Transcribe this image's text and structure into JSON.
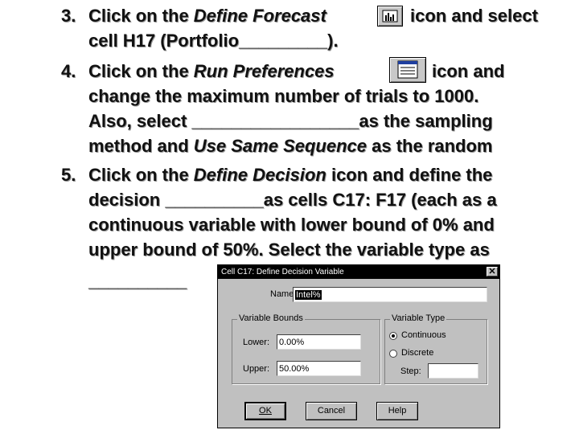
{
  "steps": [
    {
      "number": "3.",
      "line1": {
        "a": "Click on the ",
        "b": "Define Forecast",
        "c": "icon and select"
      },
      "line2": "cell H17 (Portfolio_________)."
    },
    {
      "number": "4.",
      "line1": {
        "a": "Click on the ",
        "b": "Run Preferences",
        "c": "icon and"
      },
      "line2": "change the maximum number of trials to 1000.",
      "line3": "Also, select _________________as the sampling",
      "line4": {
        "a": "method and ",
        "b": "Use Same Sequence",
        "c": " as the random"
      }
    },
    {
      "number": "5.",
      "line1": {
        "a": "Click on the ",
        "b": "Define Decision",
        "c": " icon and define the"
      },
      "line2": "decision __________as cells C17: F17 (each as a",
      "line3": "continuous variable with lower bound of 0% and",
      "line4": "upper bound of 50%.  Select the variable type as",
      "line5": "__________"
    }
  ],
  "icons": {
    "define_forecast": "bar-chart-icon",
    "run_preferences": "preferences-list-icon"
  },
  "dialog": {
    "title": "Cell C17: Define Decision Variable",
    "close": "✕",
    "name_label": "Name:",
    "name_value": "Intel%",
    "bounds_group": "Variable Bounds",
    "lower_label": "Lower:",
    "lower_value": "0.00%",
    "upper_label": "Upper:",
    "upper_value": "50.00%",
    "type_group": "Variable Type",
    "continuous_label": "Continuous",
    "discrete_label": "Discrete",
    "step_label": "Step:",
    "step_value": "",
    "selected_type": "Continuous",
    "ok_label": "OK",
    "cancel_label": "Cancel",
    "help_label": "Help"
  }
}
